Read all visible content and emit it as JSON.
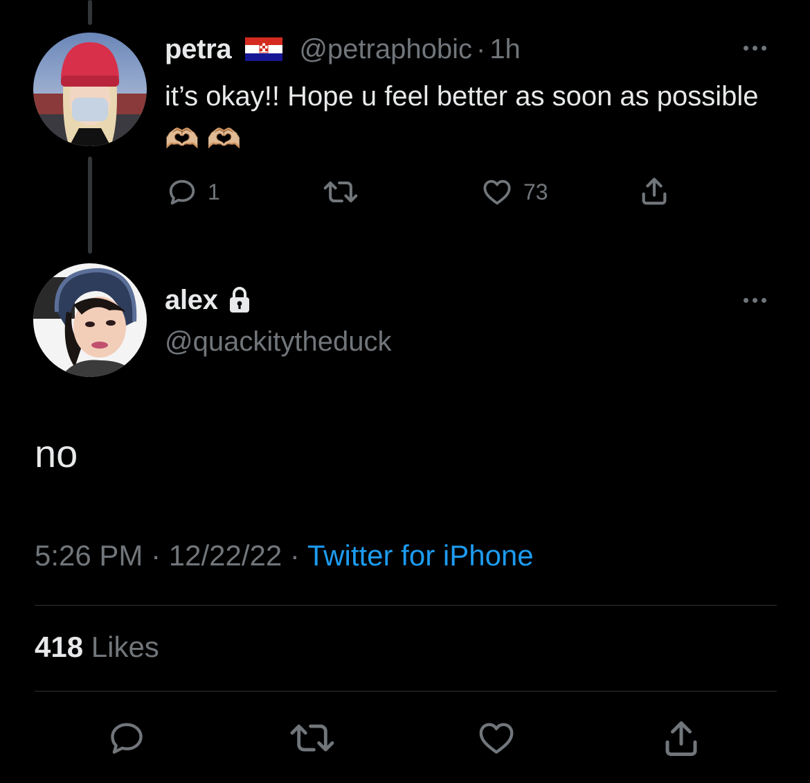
{
  "reply_tweet": {
    "display_name": "petra",
    "flag": "🇭🇷",
    "handle": "@petraphobic",
    "separator": "·",
    "time": "1h",
    "text": "it’s okay!! Hope u feel better as soon as possible 🫶🏼 🫶🏼",
    "actions": {
      "reply_count": "1",
      "retweet_count": "",
      "like_count": "73"
    }
  },
  "main_tweet": {
    "display_name": "alex",
    "handle": "@quackitytheduck",
    "text": "no",
    "time": "5:26 PM",
    "date": "12/22/22",
    "separator": " · ",
    "source": "Twitter for iPhone",
    "likes_count": "418",
    "likes_label": "Likes"
  },
  "colors": {
    "background": "#000000",
    "text_primary": "#e7e9ea",
    "text_secondary": "#71767b",
    "accent": "#1d9bf0",
    "divider": "#2f3336"
  },
  "icons": [
    "reply-icon",
    "retweet-icon",
    "like-icon",
    "share-icon",
    "lock-icon",
    "more-icon"
  ]
}
